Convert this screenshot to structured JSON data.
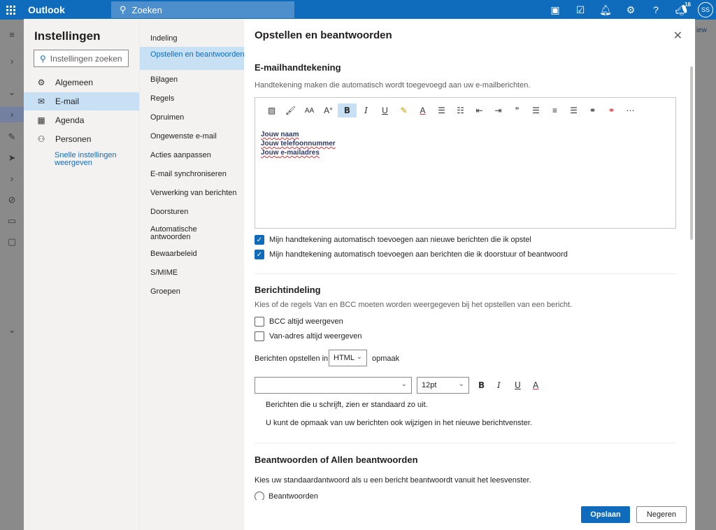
{
  "topbar": {
    "app_name": "Outlook",
    "search_placeholder": "Zoeken",
    "notification_count": "16",
    "avatar_initials": "SS"
  },
  "background": {
    "new_label": "iew"
  },
  "settings": {
    "title": "Instellingen",
    "search_placeholder": "Instellingen zoeken",
    "categories": [
      {
        "label": "Algemeen",
        "icon": "gear-icon"
      },
      {
        "label": "E-mail",
        "icon": "mail-icon"
      },
      {
        "label": "Agenda",
        "icon": "calendar-icon"
      },
      {
        "label": "Personen",
        "icon": "people-icon"
      }
    ],
    "quick_settings_link": "Snelle instellingen weergeven"
  },
  "email_subsections": [
    "Indeling",
    "Opstellen en beantwoorden",
    "Bijlagen",
    "Regels",
    "Opruimen",
    "Ongewenste e-mail",
    "Acties aanpassen",
    "E-mail synchroniseren",
    "Verwerking van berichten",
    "Doorsturen",
    "Automatische antwoorden",
    "Bewaarbeleid",
    "S/MIME",
    "Groepen"
  ],
  "pane": {
    "title": "Opstellen en beantwoorden",
    "signature": {
      "heading": "E-mailhandtekening",
      "description": "Handtekening maken die automatisch wordt toegevoegd aan uw e-mailberichten.",
      "lines": [
        {
          "first": "Jouw",
          "rest": " naam"
        },
        {
          "first": "Jouw",
          "rest": " telefoonnummer"
        },
        {
          "first": "Jouw",
          "rest": " e-mailadres"
        }
      ],
      "auto_new_label": "Mijn handtekening automatisch toevoegen aan nieuwe berichten die ik opstel",
      "auto_new_checked": true,
      "auto_reply_label": "Mijn handtekening automatisch toevoegen aan berichten die ik doorstuur of beantwoord",
      "auto_reply_checked": true
    },
    "message_format": {
      "heading": "Berichtindeling",
      "description": "Kies of de regels Van en BCC moeten worden weergegeven bij het opstellen van een bericht.",
      "bcc_label": "BCC altijd weergeven",
      "bcc_checked": false,
      "from_label": "Van-adres altijd weergeven",
      "from_checked": false,
      "compose_prefix": "Berichten opstellen in",
      "compose_value": "HTML",
      "compose_suffix": "opmaak",
      "font_value": "",
      "size_value": "12pt",
      "preview_line1": "Berichten die u schrijft, zien er standaard zo uit.",
      "preview_line2": "U kunt de opmaak van uw berichten ook wijzigen in het nieuwe berichtvenster."
    },
    "reply": {
      "heading": "Beantwoorden of Allen beantwoorden",
      "description": "Kies uw standaardantwoord als u een bericht beantwoordt vanuit het leesvenster.",
      "option1": "Beantwoorden"
    }
  },
  "footer": {
    "save_label": "Opslaan",
    "discard_label": "Negeren"
  },
  "colors": {
    "accent": "#0f6cbd",
    "selected": "#c7e0f4",
    "error_underline": "#d13438"
  }
}
